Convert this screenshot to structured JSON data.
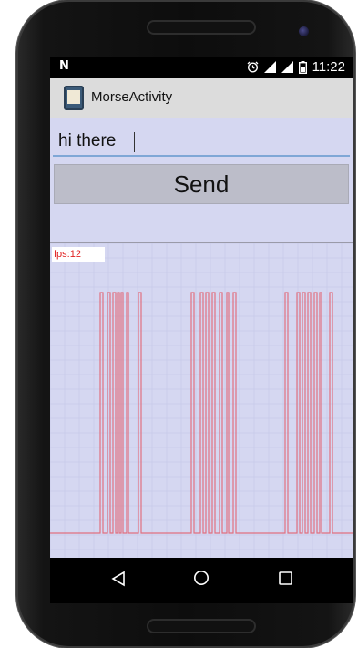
{
  "status_bar": {
    "carrier_icon": "N",
    "time": "11:22",
    "icons": [
      "alarm-icon",
      "signal-icon",
      "signal-icon",
      "battery-icon"
    ]
  },
  "action_bar": {
    "title": "MorseActivity",
    "app_icon": "app-launcher-icon"
  },
  "form": {
    "input_value": "hi there",
    "send_label": "Send"
  },
  "graph": {
    "fps_label": "fps:12",
    "line_color": "#e07080",
    "background": "#d5d7f1",
    "grid_color": "#c4c6e6"
  },
  "nav_bar": {
    "buttons": [
      "back-icon",
      "home-icon",
      "recents-icon"
    ]
  },
  "colors": {
    "content_bg": "#d5d7f1",
    "action_bar_bg": "#dcdcdc",
    "button_bg": "#bcbdc9",
    "input_underline": "#7fa7d6"
  }
}
